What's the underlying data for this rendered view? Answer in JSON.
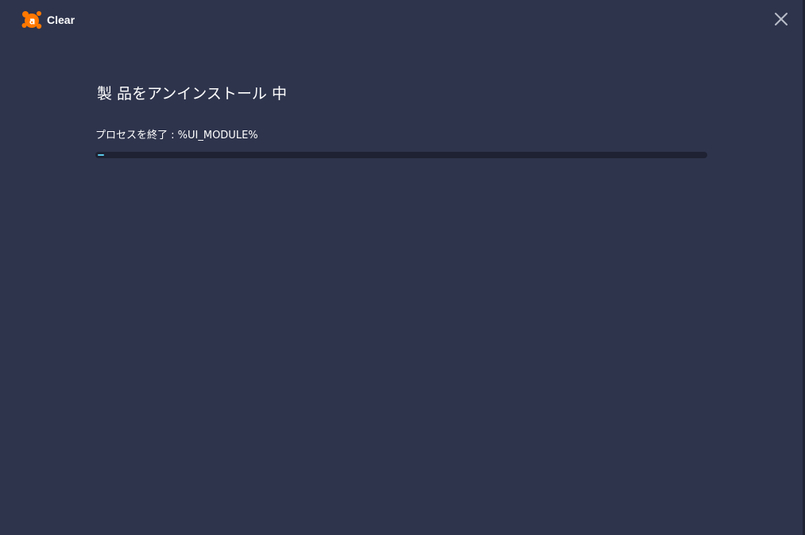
{
  "app": {
    "title": "Clear",
    "logo_icon": "avast-logo-icon",
    "close_icon": "close-icon"
  },
  "main": {
    "heading": "製 品をアンインストール 中",
    "status_text": "プロセスを終了 : %UI_MODULE%",
    "progress_fraction": 0.01
  },
  "colors": {
    "background": "#2e344c",
    "progress_track": "#1e2232",
    "progress_fill": "#5ac8e8",
    "brand_orange": "#ff7800"
  }
}
